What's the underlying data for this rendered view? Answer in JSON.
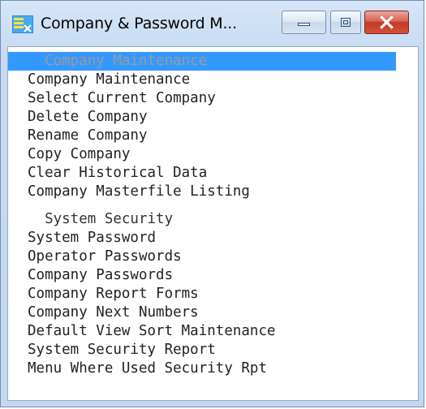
{
  "window": {
    "title": "Company & Password M...",
    "controls": {
      "minimize": "minimize",
      "maximize": "maximize",
      "close": "close"
    }
  },
  "icons": {
    "app": "app-menu-icon",
    "minimize": "minimize-icon",
    "maximize": "maximize-icon",
    "close": "close-icon"
  },
  "colors": {
    "selection": "#3399ff",
    "close_button": "#c23b26",
    "title_bar": "#c7dbf2"
  },
  "menu": {
    "company_section": {
      "header": "  Company Maintenance",
      "items": [
        "Company Maintenance",
        "Select Current Company",
        "Delete Company",
        "Rename Company",
        "Copy Company",
        "Clear Historical Data",
        "Company Masterfile Listing"
      ]
    },
    "security_section": {
      "header": "  System Security",
      "items": [
        "System Password",
        "Operator Passwords",
        "Company Passwords",
        "Company Report Forms",
        "Company Next Numbers",
        "Default View Sort Maintenance",
        "System Security Report",
        "Menu Where Used Security Rpt"
      ]
    }
  }
}
